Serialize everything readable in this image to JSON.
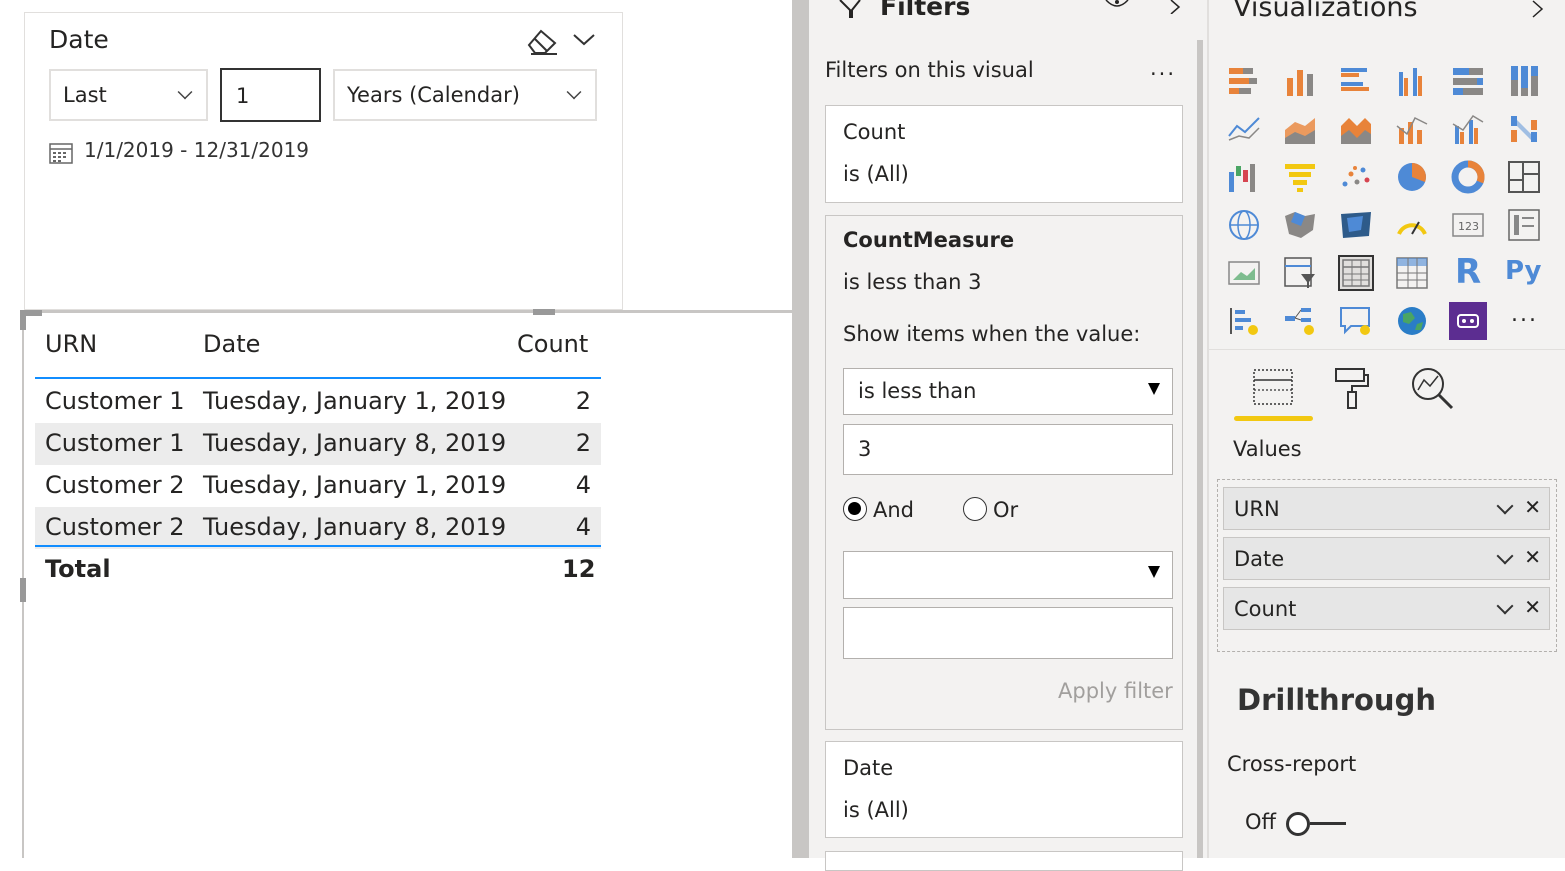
{
  "slicer": {
    "title": "Date",
    "relative_option": "Last",
    "number": "1",
    "period": "Years (Calendar)",
    "range_text": "1/1/2019 - 12/31/2019"
  },
  "table": {
    "headers": [
      "URN",
      "Date",
      "Count"
    ],
    "rows": [
      {
        "urn": "Customer 1",
        "date": "Tuesday, January 1, 2019",
        "count": "2"
      },
      {
        "urn": "Customer 1",
        "date": "Tuesday, January 8, 2019",
        "count": "2"
      },
      {
        "urn": "Customer 2",
        "date": "Tuesday, January 1, 2019",
        "count": "4"
      },
      {
        "urn": "Customer 2",
        "date": "Tuesday, January 8, 2019",
        "count": "4"
      }
    ],
    "total_label": "Total",
    "total_value": "12"
  },
  "filters": {
    "title": "Filters",
    "section_label": "Filters on this visual",
    "more": "...",
    "count_card": {
      "name": "Count",
      "state": "is (All)"
    },
    "measure_card": {
      "name": "CountMeasure",
      "summary": "is less than 3",
      "show_items_label": "Show items when the value:",
      "condition": "is less than",
      "value": "3",
      "and_label": "And",
      "or_label": "Or",
      "condition2": "",
      "value2": "",
      "apply_label": "Apply filter"
    },
    "date_card": {
      "name": "Date",
      "state": "is (All)"
    }
  },
  "visualizations": {
    "title": "Visualizations",
    "more": "...",
    "values_label": "Values",
    "fields": [
      "URN",
      "Date",
      "Count"
    ],
    "drillthrough_title": "Drillthrough",
    "cross_report_label": "Cross-report",
    "toggle_state": "Off",
    "icon_rows": [
      [
        "stacked-bar-icon",
        "stacked-column-icon",
        "clustered-bar-icon",
        "clustered-column-icon",
        "100-stacked-bar-icon",
        "100-stacked-column-icon"
      ],
      [
        "line-chart-icon",
        "area-chart-icon",
        "stacked-area-icon",
        "line-column-icon",
        "line-clustered-column-icon",
        "ribbon-chart-icon"
      ],
      [
        "waterfall-icon",
        "funnel-icon",
        "scatter-icon",
        "pie-icon",
        "donut-icon",
        "treemap-icon"
      ],
      [
        "map-icon",
        "filled-map-icon",
        "shape-map-icon",
        "gauge-icon",
        "card-icon",
        "multi-row-card-icon"
      ],
      [
        "kpi-icon",
        "slicer-icon",
        "table-icon",
        "matrix-icon",
        "r-visual-icon",
        "python-visual-icon"
      ],
      [
        "key-influencers-icon",
        "decomposition-tree-icon",
        "qna-icon",
        "arcgis-map-icon",
        "custom-visual-icon",
        "more-visuals-icon"
      ]
    ],
    "r_glyph": "R",
    "py_glyph": "Py"
  },
  "colors": {
    "accent_yellow": "#f2c811",
    "table_rule": "#118dff",
    "purple": "#5c2d91"
  }
}
